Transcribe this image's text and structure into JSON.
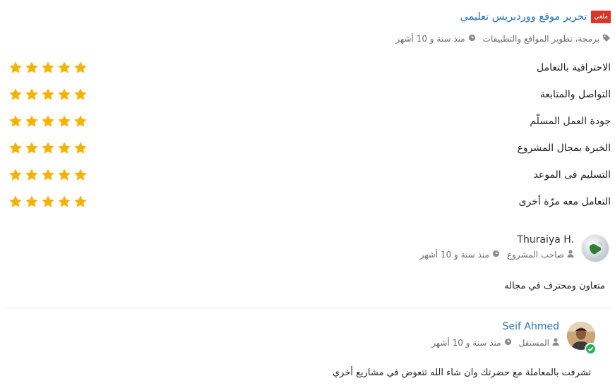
{
  "header": {
    "badge": "ملغي",
    "project_title": "تحرير موقع ووردبريس تعليمي",
    "category": "برمجة، تطوير المواقع والتطبيقات",
    "time": "منذ سنة و 10 أشهر"
  },
  "ratings": [
    {
      "label": "الاحترافية بالتعامل",
      "stars": 5
    },
    {
      "label": "التواصل والمتابعة",
      "stars": 5
    },
    {
      "label": "جودة العمل المسلّم",
      "stars": 5
    },
    {
      "label": "الخبرة بمجال المشروع",
      "stars": 5
    },
    {
      "label": "التسليم فى الموعد",
      "stars": 5
    },
    {
      "label": "التعامل معه مرّة أخرى",
      "stars": 5
    }
  ],
  "reviews": [
    {
      "name": "Thuraiya H.",
      "role": "صاحب المشروع",
      "time": "منذ سنة و 10 أشهر",
      "comment": "متعاون ومحترف في مجاله"
    },
    {
      "name": "Seif Ahmed",
      "role": "المستقل",
      "time": "منذ سنة و 10 أشهر",
      "comment": "تشرفت بالمعاملة مع حضرتك وان شاء الله تتعوض في مشاريع أخري"
    }
  ],
  "colors": {
    "star": "#f5b301",
    "link": "#2a73bd",
    "badge": "#d9362b",
    "online": "#27ae60"
  },
  "icons": {
    "tag": "tag-icon",
    "clock": "clock-icon",
    "user": "user-icon",
    "star": "star-icon"
  }
}
